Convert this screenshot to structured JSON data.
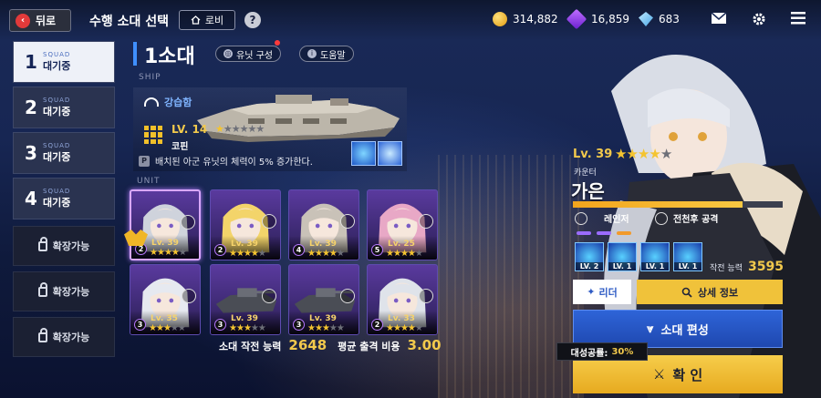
{
  "header": {
    "back_label": "뒤로",
    "title": "수행 소대 선택",
    "lobby_label": "로비",
    "help_label": "?",
    "gold": "314,882",
    "gems": "16,859",
    "crystals": "683"
  },
  "squads": [
    {
      "num": "1",
      "sub": "SQUAD",
      "status": "대기중"
    },
    {
      "num": "2",
      "sub": "SQUAD",
      "status": "대기중"
    },
    {
      "num": "3",
      "sub": "SQUAD",
      "status": "대기중"
    },
    {
      "num": "4",
      "sub": "SQUAD",
      "status": "대기중"
    }
  ],
  "expand_label": "확장가능",
  "squad": {
    "title": "1소대",
    "unit_config_label": "유닛 구성",
    "help_label": "도움말",
    "ship_section": "SHIP",
    "unit_section": "UNIT"
  },
  "ship": {
    "type": "강습함",
    "level": "LV. 14",
    "name": "코핀",
    "stars": 1,
    "max_stars": 6,
    "p_badge": "P",
    "description": "배치된 아군 유닛의 체력이 5% 증가한다."
  },
  "units": [
    {
      "num": "2",
      "lv": "Lv. 39",
      "stars": 4
    },
    {
      "num": "2",
      "lv": "Lv. 39",
      "stars": 4
    },
    {
      "num": "4",
      "lv": "Lv. 39",
      "stars": 4
    },
    {
      "num": "5",
      "lv": "Lv. 25",
      "stars": 4
    },
    {
      "num": "3",
      "lv": "Lv. 35",
      "stars": 3
    },
    {
      "num": "3",
      "lv": "Lv. 39",
      "stars": 3
    },
    {
      "num": "3",
      "lv": "Lv. 39",
      "stars": 3
    },
    {
      "num": "2",
      "lv": "Lv. 33",
      "stars": 4
    }
  ],
  "footer": {
    "power_label": "소대 작전 능력",
    "power_value": "2648",
    "cost_label": "평균 출격 비용",
    "cost_value": "3.00"
  },
  "character": {
    "level": "Lv. 39",
    "stars": 4,
    "class": "카운터",
    "name": "가은",
    "hp_fraction": 0.81,
    "role": "레인저",
    "attack_type": "전천후 공격",
    "skills": [
      "LV. 2",
      "LV. 1",
      "LV. 1",
      "LV. 1"
    ],
    "power_label": "작전 능력",
    "power_value": "3595",
    "leader_label": "리더",
    "detail_label": "상세 정보",
    "edit_label": "소대 편성",
    "confirm_label": "확 인",
    "tooltip_label": "대성공률:",
    "tooltip_value": "30%"
  },
  "colors": {
    "accent_gold": "#f2c94c",
    "accent_blue": "#2e64d8",
    "confirm": "#f0c23a"
  }
}
